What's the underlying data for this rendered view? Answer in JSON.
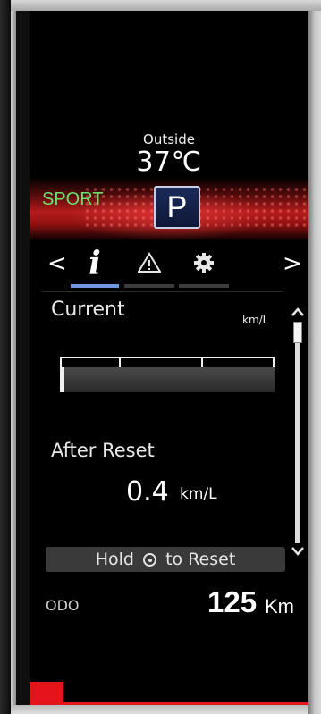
{
  "header": {
    "outside_label": "Outside",
    "temperature": "37℃",
    "drive_mode": "SPORT",
    "gear": "P"
  },
  "nav": {
    "prev_glyph": "<",
    "next_glyph": ">",
    "tabs": [
      {
        "name": "info",
        "glyph": "i",
        "active": true
      },
      {
        "name": "warning",
        "icon": "warning-triangle-icon",
        "active": false
      },
      {
        "name": "settings",
        "icon": "gear-icon",
        "active": false
      }
    ]
  },
  "fuel": {
    "current_label": "Current",
    "unit": "km/L",
    "current_fill_fraction": 0.02,
    "after_reset_label": "After Reset",
    "after_reset_value": "0.4",
    "after_reset_unit": "km/L"
  },
  "reset": {
    "prefix": "Hold",
    "suffix": "to Reset"
  },
  "odo": {
    "label": "ODO",
    "value": "125",
    "unit": "Km"
  },
  "colors": {
    "sport_green": "#6fe06a",
    "active_tab": "#7098e0",
    "accent_red": "#e4141b",
    "gear_bg": "#16224a"
  }
}
